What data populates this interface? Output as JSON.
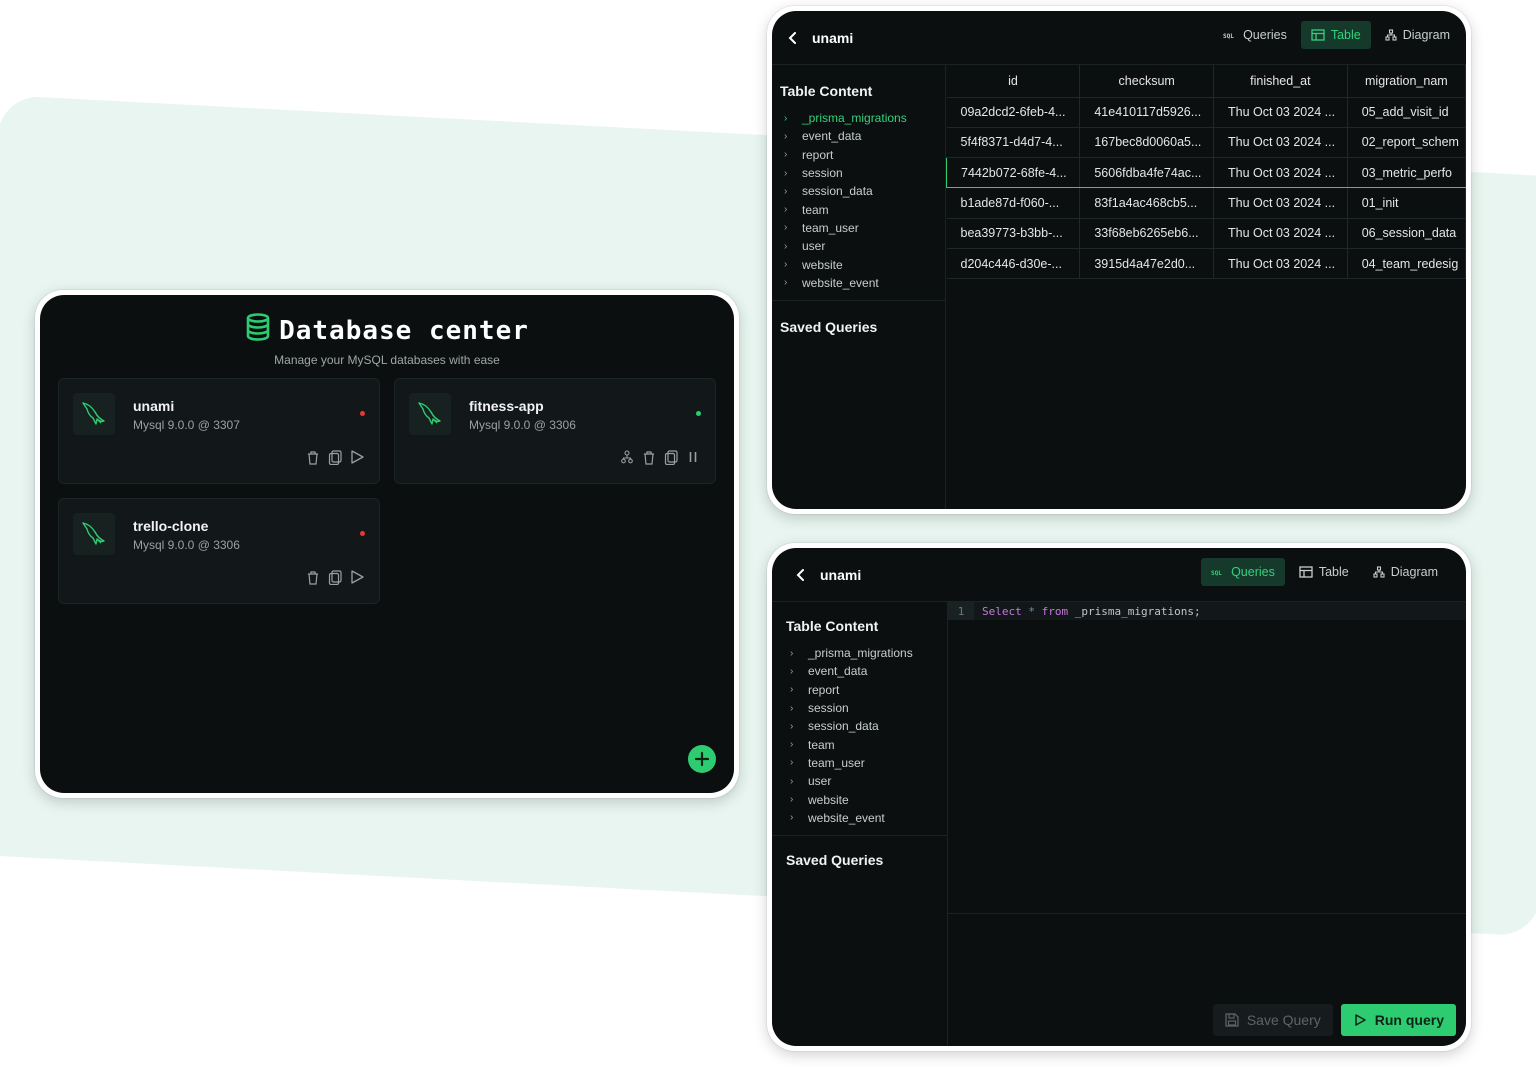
{
  "colors": {
    "accent": "#2ecc71",
    "online": "#2ecc71",
    "offline": "#e53935",
    "panel": "#0b0f10"
  },
  "db_center": {
    "title": "Database center",
    "subtitle": "Manage your MySQL databases with ease",
    "cards": [
      {
        "name": "unami",
        "meta": "Mysql 9.0.0 @ 3307",
        "status": "offline"
      },
      {
        "name": "fitness-app",
        "meta": "Mysql 9.0.0 @ 3306",
        "status": "online"
      },
      {
        "name": "trello-clone",
        "meta": "Mysql 9.0.0 @ 3306",
        "status": "offline"
      }
    ]
  },
  "table_view": {
    "db_name": "unami",
    "tabs": [
      "Queries",
      "Table",
      "Diagram"
    ],
    "active_tab": "Table",
    "sidebar_title": "Table Content",
    "saved_title": "Saved Queries",
    "tables": [
      "_prisma_migrations",
      "event_data",
      "report",
      "session",
      "session_data",
      "team",
      "team_user",
      "user",
      "website",
      "website_event"
    ],
    "columns": [
      "id",
      "checksum",
      "finished_at",
      "migration_nam"
    ],
    "rows": [
      [
        "09a2dcd2-6feb-4...",
        "41e410117d5926...",
        "Thu Oct 03 2024 ...",
        "05_add_visit_id"
      ],
      [
        "5f4f8371-d4d7-4...",
        "167bec8d0060a5...",
        "Thu Oct 03 2024 ...",
        "02_report_schem"
      ],
      [
        "7442b072-68fe-4...",
        "5606fdba4fe74ac...",
        "Thu Oct 03 2024 ...",
        "03_metric_perfo"
      ],
      [
        "b1ade87d-f060-...",
        "83f1a4ac468cb5...",
        "Thu Oct 03 2024 ...",
        "01_init"
      ],
      [
        "bea39773-b3bb-...",
        "33f68eb6265eb6...",
        "Thu Oct 03 2024 ...",
        "06_session_data"
      ],
      [
        "d204c446-d30e-...",
        "3915d4a47e2d0...",
        "Thu Oct 03 2024 ...",
        "04_team_redesig"
      ]
    ]
  },
  "query_view": {
    "db_name": "unami",
    "tabs": [
      "Queries",
      "Table",
      "Diagram"
    ],
    "active_tab": "Queries",
    "sidebar_title": "Table Content",
    "saved_title": "Saved Queries",
    "tables": [
      "_prisma_migrations",
      "event_data",
      "report",
      "session",
      "session_data",
      "team",
      "team_user",
      "user",
      "website",
      "website_event"
    ],
    "editor": {
      "line_number": "1",
      "kw1": "Select",
      "star": "*",
      "kw2": "from",
      "target": "_prisma_migrations;"
    },
    "save_label": "Save Query",
    "run_label": "Run query"
  }
}
